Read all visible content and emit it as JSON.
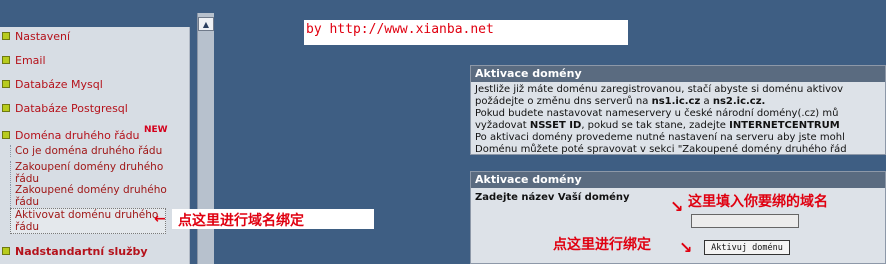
{
  "sidebar": {
    "items": [
      {
        "label": "Nastavení"
      },
      {
        "label": "Email"
      },
      {
        "label": "Databáze Mysql"
      },
      {
        "label": "Databáze Postgresql"
      },
      {
        "label": "Doména druhého řádu",
        "badge": "NEW"
      },
      {
        "label": "Nadstandartní služby"
      }
    ],
    "sub_items": [
      {
        "label": "Co je doména druhého řádu"
      },
      {
        "label": "Zakoupení domény druhého řádu"
      },
      {
        "label": "Zakoupené domény druhého řádu"
      },
      {
        "label": "Aktivovat doménu druhého řádu"
      }
    ]
  },
  "watermark": "by http://www.xianba.net",
  "panel_info": {
    "title": "Aktivace domény",
    "lines": [
      "Jestliže již máte doménu zaregistrovanou, stačí abyste si doménu aktivov",
      "požádejte o změnu dns serverů na",
      "ns1.ic.cz",
      "a",
      "ns2.ic.cz.",
      "Pokud budete nastavovat nameservery u české národní domény(.cz) mů",
      "vyžadovat",
      "NSSET ID",
      ", pokud se tak stane, zadejte",
      "INTERNETCENTRUM",
      "Po aktivaci domény provedeme nutné nastavení na serveru aby jste mohl",
      "Doménu můžete poté spravovat v sekci \"Zakoupené domény druhého řád"
    ]
  },
  "panel_form": {
    "title": "Aktivace domény",
    "field_label": "Zadejte název Vaší domény",
    "input_value": "",
    "button_label": "Aktivuj doménu"
  },
  "annotations": {
    "sidebar_note": "点这里进行域名绑定",
    "input_note": "这里填入你要绑的域名",
    "button_note": "点这里进行绑定"
  }
}
